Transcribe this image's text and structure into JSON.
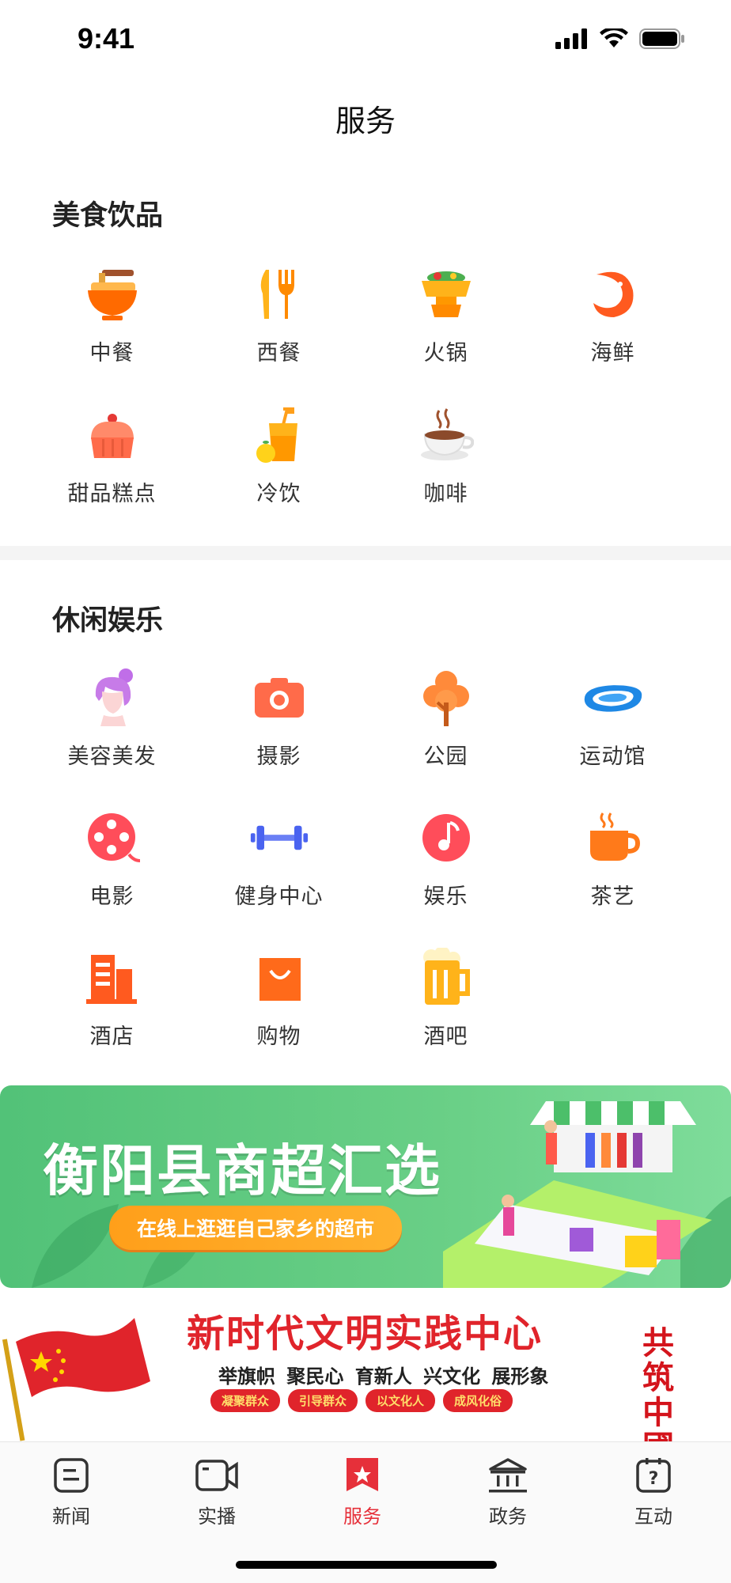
{
  "status_bar": {
    "time": "9:41"
  },
  "page": {
    "title": "服务"
  },
  "sections": [
    {
      "title": "美食饮品",
      "items": [
        {
          "label": "中餐",
          "icon": "noodle-bowl-icon"
        },
        {
          "label": "西餐",
          "icon": "fork-knife-icon"
        },
        {
          "label": "火锅",
          "icon": "hotpot-icon"
        },
        {
          "label": "海鲜",
          "icon": "shrimp-icon"
        },
        {
          "label": "甜品糕点",
          "icon": "cupcake-icon"
        },
        {
          "label": "冷饮",
          "icon": "cold-drink-icon"
        },
        {
          "label": "咖啡",
          "icon": "coffee-cup-icon"
        }
      ]
    },
    {
      "title": "休闲娱乐",
      "items": [
        {
          "label": "美容美发",
          "icon": "hair-salon-icon"
        },
        {
          "label": "摄影",
          "icon": "camera-icon"
        },
        {
          "label": "公园",
          "icon": "tree-icon"
        },
        {
          "label": "运动馆",
          "icon": "stadium-icon"
        },
        {
          "label": "电影",
          "icon": "film-reel-icon"
        },
        {
          "label": "健身中心",
          "icon": "dumbbell-icon"
        },
        {
          "label": "娱乐",
          "icon": "music-note-icon"
        },
        {
          "label": "茶艺",
          "icon": "tea-cup-icon"
        },
        {
          "label": "酒店",
          "icon": "hotel-building-icon"
        },
        {
          "label": "购物",
          "icon": "shopping-bag-icon"
        },
        {
          "label": "酒吧",
          "icon": "beer-mug-icon"
        }
      ]
    }
  ],
  "banners": [
    {
      "headline": "衡阳县商超汇选",
      "tagline": "在线上逛逛自己家乡的超市"
    },
    {
      "headline": "新时代文明实践中心",
      "subline": "举旗帜 聚民心 育新人 兴文化 展形象",
      "tags": [
        "凝聚群众",
        "引导群众",
        "以文化人",
        "成风化俗"
      ],
      "side": "共筑中國"
    }
  ],
  "tabbar": {
    "active": "服务",
    "tabs": [
      {
        "label": "新闻",
        "icon": "news-icon"
      },
      {
        "label": "实播",
        "icon": "video-camera-icon"
      },
      {
        "label": "服务",
        "icon": "service-star-icon"
      },
      {
        "label": "政务",
        "icon": "government-building-icon"
      },
      {
        "label": "互动",
        "icon": "question-calendar-icon"
      }
    ]
  },
  "colors": {
    "accent": "#e6303a",
    "banner_green": "#5cc77f",
    "icon_orange": "#ff7a1a"
  }
}
